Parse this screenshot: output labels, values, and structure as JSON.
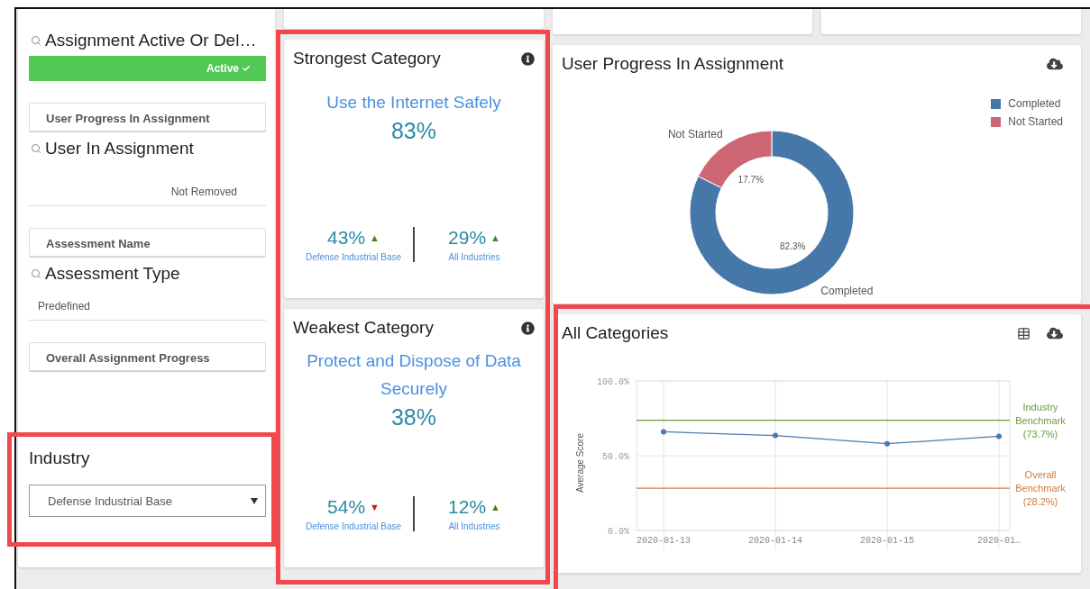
{
  "left_panel": {
    "items": [
      {
        "kind": "heading",
        "text": "Assignment Active Or Del…"
      },
      {
        "kind": "status_bar",
        "text": "Active",
        "checked": true
      },
      {
        "kind": "box",
        "text": "User Progress In Assignment"
      },
      {
        "kind": "heading",
        "text": "User In Assignment"
      },
      {
        "kind": "value_right",
        "text": "Not Removed"
      },
      {
        "kind": "box",
        "text": "Assessment Name"
      },
      {
        "kind": "heading",
        "text": "Assessment Type"
      },
      {
        "kind": "value",
        "text": "Predefined"
      },
      {
        "kind": "box",
        "text": "Overall Assignment Progress"
      }
    ]
  },
  "industry": {
    "label": "Industry",
    "select": {
      "value": "Defense Industrial Base"
    }
  },
  "category_cards": [
    {
      "title": "Strongest Category",
      "category": "Use the Internet Safely",
      "score": "83%",
      "comparisons": [
        {
          "value": "43%",
          "label": "Defense Industrial Base",
          "arrow": "▲",
          "color": "#3f8a1c"
        },
        {
          "value": "29%",
          "label": "All Industries",
          "arrow": "▲",
          "color": "#3f8a1c"
        }
      ]
    },
    {
      "title": "Weakest Category",
      "category": "Protect and Dispose of Data Securely",
      "score": "38%",
      "comparisons": [
        {
          "value": "54%",
          "label": "Defense Industrial Base",
          "arrow": "▼",
          "color": "#c8161d"
        },
        {
          "value": "12%",
          "label": "All Industries",
          "arrow": "▲",
          "color": "#3f8a1c"
        }
      ]
    }
  ],
  "progress_card": {
    "title": "User Progress In Assignment",
    "chart_data": {
      "type": "donut",
      "categories": [
        "Completed",
        "Not Started"
      ],
      "values": [
        82.3,
        17.7
      ],
      "colors": [
        "#4577a9",
        "#cc6574"
      ],
      "value_labels": [
        "82.3%",
        "17.7%"
      ]
    }
  },
  "categories_card": {
    "title": "All Categories",
    "chart_data": {
      "type": "line",
      "ylabel": "Average Score",
      "categories": [
        "2020-01-13",
        "2020-01-14",
        "2020-01-15",
        "2020-01…"
      ],
      "series": [
        {
          "color": "#4a7bb0",
          "marker": "o",
          "values": [
            66,
            63.5,
            58,
            63
          ]
        }
      ],
      "grid": true,
      "ylim": [
        0,
        100
      ],
      "yticks": [
        {
          "value": 0,
          "label": "0.0%"
        },
        {
          "value": 50,
          "label": "50.0%"
        },
        {
          "value": 100,
          "label": "100.0%"
        }
      ],
      "ref_lines": [
        {
          "axis": "y",
          "value": 73.7,
          "label": "Industry Benchmark (73.7%)",
          "color": "#6b9a3e"
        },
        {
          "axis": "y",
          "value": 28.2,
          "label": "Overall Benchmark (28.2%)",
          "color": "#d07a3c"
        }
      ]
    }
  }
}
